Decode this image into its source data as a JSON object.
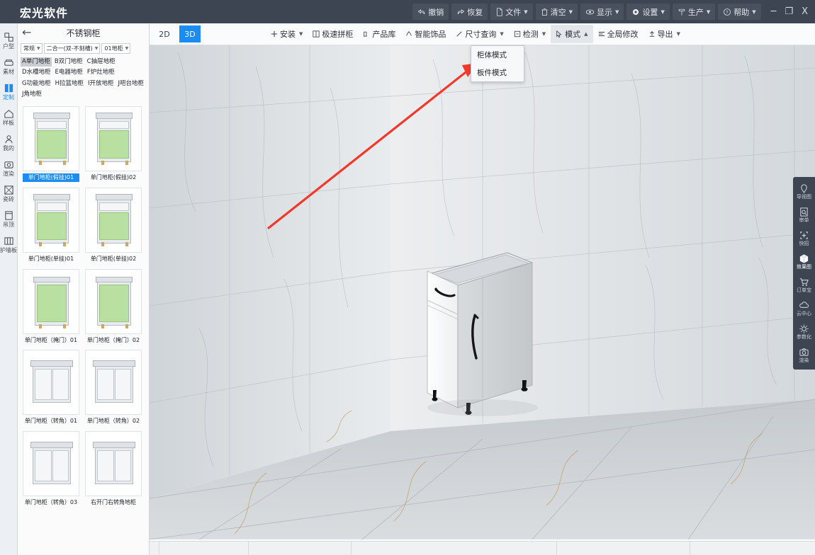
{
  "app": {
    "title": "宏光软件"
  },
  "titlebar": {
    "tools": [
      {
        "label": "撤销",
        "icon": "undo-icon",
        "caret": false
      },
      {
        "label": "恢复",
        "icon": "redo-icon",
        "caret": false
      },
      {
        "label": "文件",
        "icon": "file-icon",
        "caret": true
      },
      {
        "label": "清空",
        "icon": "trash-icon",
        "caret": true
      },
      {
        "label": "显示",
        "icon": "eye-icon",
        "caret": true
      },
      {
        "label": "设置",
        "icon": "gear-icon",
        "caret": true
      },
      {
        "label": "生产",
        "icon": "production-icon",
        "caret": true
      },
      {
        "label": "帮助",
        "icon": "help-icon",
        "caret": true
      }
    ],
    "window": {
      "minimize": "─",
      "maximize": "❐",
      "close": "X"
    }
  },
  "rail": {
    "items": [
      {
        "label": "户型",
        "icon": "floorplan-icon",
        "active": false
      },
      {
        "label": "素材",
        "icon": "material-icon",
        "active": false
      },
      {
        "label": "定制",
        "icon": "custom-icon",
        "active": true
      },
      {
        "label": "样板",
        "icon": "template-icon",
        "active": false
      },
      {
        "label": "我的",
        "icon": "user-icon",
        "active": false
      },
      {
        "label": "渲染",
        "icon": "render-icon",
        "active": false
      },
      {
        "label": "瓷砖",
        "icon": "tile-icon",
        "active": false
      },
      {
        "label": "吊顶",
        "icon": "ceiling-icon",
        "active": false
      },
      {
        "label": "护墙板",
        "icon": "wallpanel-icon",
        "active": false
      }
    ]
  },
  "panel": {
    "back": "←",
    "title": "不锈钢柜",
    "filters": [
      {
        "value": "常规"
      },
      {
        "value": "二合一(双-不刻槽)"
      },
      {
        "value": "01地柜"
      }
    ],
    "categories": [
      {
        "label": "A单门地柜",
        "selected": true
      },
      {
        "label": "B双门地柜",
        "selected": false
      },
      {
        "label": "C抽屉地柜",
        "selected": false
      },
      {
        "label": "D水槽地柜",
        "selected": false
      },
      {
        "label": "E电器地柜",
        "selected": false
      },
      {
        "label": "F炉灶地柜",
        "selected": false
      },
      {
        "label": "G功能地柜",
        "selected": false
      },
      {
        "label": "H拉篮地柜",
        "selected": false
      },
      {
        "label": "I开放地柜",
        "selected": false
      },
      {
        "label": "J吧台地柜",
        "selected": false
      },
      {
        "label": "J角地柜",
        "selected": false
      }
    ],
    "products": [
      {
        "label": "单门地柜(假挂)01",
        "selected": true,
        "style": "drawer-door-green"
      },
      {
        "label": "单门地柜(假挂)02",
        "selected": false,
        "style": "drawer-door-green"
      },
      {
        "label": "单门地柜(单挂)01",
        "selected": false,
        "style": "drawer-door-green"
      },
      {
        "label": "单门地柜(单挂)02",
        "selected": false,
        "style": "drawer-door-green"
      },
      {
        "label": "单门地柜（掩门）01",
        "selected": false,
        "style": "door-green"
      },
      {
        "label": "单门地柜（掩门）02",
        "selected": false,
        "style": "door-green"
      },
      {
        "label": "单门地柜（转角）01",
        "selected": false,
        "style": "corner-white"
      },
      {
        "label": "单门地柜（转角）02",
        "selected": false,
        "style": "corner-white"
      },
      {
        "label": "单门地柜（转角）03",
        "selected": false,
        "style": "corner-white"
      },
      {
        "label": "右开门右转角地柜",
        "selected": false,
        "style": "corner-white"
      }
    ]
  },
  "toolbar": {
    "view_tabs": [
      {
        "label": "2D",
        "active": false
      },
      {
        "label": "3D",
        "active": true
      }
    ],
    "items": [
      {
        "label": "安装",
        "icon": "plus-icon",
        "caret": true,
        "open": false
      },
      {
        "label": "极速拼柜",
        "icon": "grid-icon",
        "caret": false,
        "open": false
      },
      {
        "label": "产品库",
        "icon": "library-icon",
        "caret": false,
        "open": false
      },
      {
        "label": "智能饰品",
        "icon": "ornament-icon",
        "caret": false,
        "open": false
      },
      {
        "label": "尺寸查询",
        "icon": "ruler-icon",
        "caret": true,
        "open": false
      },
      {
        "label": "检测",
        "icon": "inspect-icon",
        "caret": true,
        "open": false
      },
      {
        "label": "模式",
        "icon": "cursor-icon",
        "caret": true,
        "open": true
      },
      {
        "label": "全局修改",
        "icon": "sliders-icon",
        "caret": false,
        "open": false
      },
      {
        "label": "导出",
        "icon": "export-icon",
        "caret": true,
        "open": false
      }
    ],
    "mode_menu": {
      "items": [
        {
          "label": "柜体模式",
          "highlighted": false
        },
        {
          "label": "板件模式",
          "highlighted": true
        }
      ]
    }
  },
  "right_rail": {
    "items": [
      {
        "label": "导视图",
        "icon": "navview-icon"
      },
      {
        "label": "审单",
        "icon": "review-icon"
      },
      {
        "label": "快招",
        "icon": "quickjoin-icon"
      },
      {
        "label": "效果图",
        "icon": "cube-icon"
      },
      {
        "label": "订单宝",
        "icon": "cart-icon"
      },
      {
        "label": "云中心",
        "icon": "cloud-icon"
      },
      {
        "label": "参数化",
        "icon": "params-icon"
      },
      {
        "label": "渲染",
        "icon": "camera-icon"
      }
    ]
  },
  "scene": {
    "annotation": {
      "type": "arrow",
      "color": "#f4392c",
      "points_to": "板件模式"
    },
    "object": {
      "name": "单门地柜",
      "description": "白色单门地柜，含上抽屉、黑色把手与黑色地脚"
    }
  },
  "colors": {
    "accent": "#1b8cf2",
    "titlebar": "#3d4552",
    "annotation": "#f4392c",
    "panel_bg": "#fbfbfc"
  }
}
